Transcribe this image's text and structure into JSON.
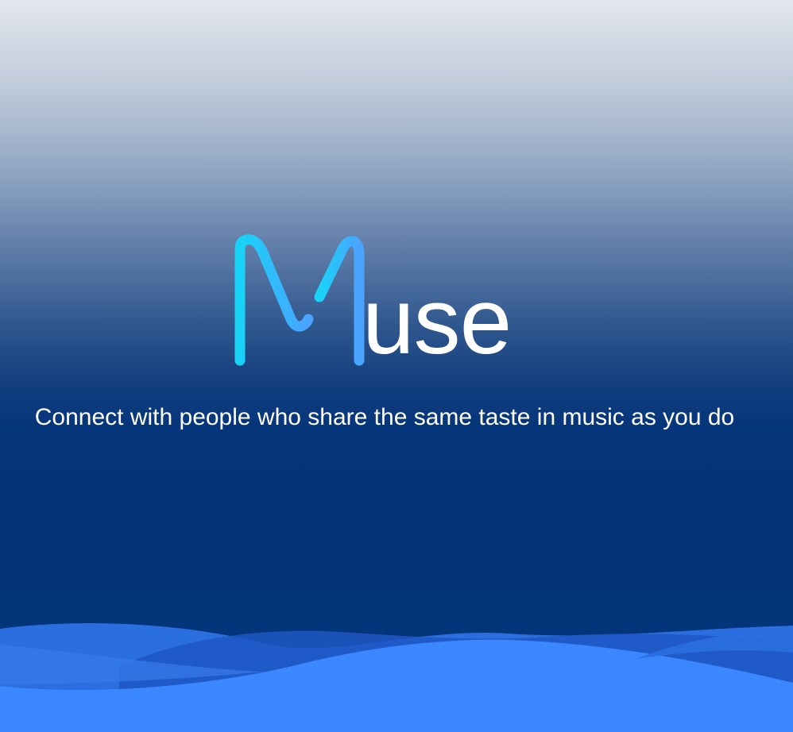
{
  "brand": {
    "logo_letter": "M",
    "logo_rest": "use",
    "colors": {
      "m_gradient_start": "#19d3f7",
      "m_gradient_end": "#4aa3ff",
      "text": "#ffffff"
    }
  },
  "tagline": "Connect with people who share the same taste in music as you do",
  "theme": {
    "background_top": "#e5e8ee",
    "background_bottom": "#02357a",
    "wave_colors": [
      "#2a6ee0",
      "#1f57c4",
      "#3a87ff"
    ]
  }
}
